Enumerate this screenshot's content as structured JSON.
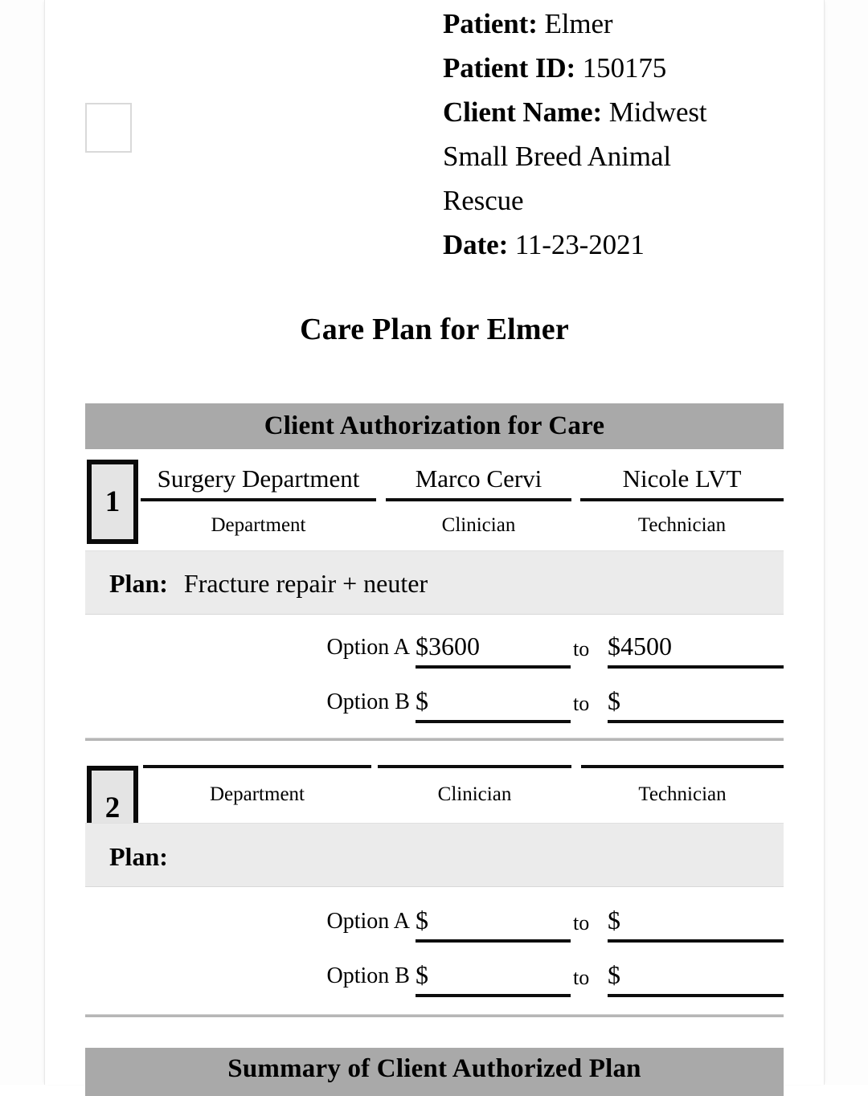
{
  "document": {
    "title": "Care Plan for Elmer",
    "header": {
      "patient_label": "Patient:",
      "patient_value": "Elmer",
      "patient_id_label": "Patient ID:",
      "patient_id_value": "150175",
      "client_name_label": "Client Name:",
      "client_name_value": "Midwest",
      "client_name_cont_1": "Small Breed Animal",
      "client_name_cont_2": "Rescue",
      "date_label": "Date:",
      "date_value": "11-23-2021"
    },
    "banners": {
      "authorization": "Client Authorization for Care",
      "summary": "Summary of Client Authorized Plan"
    },
    "captions": {
      "department": "Department",
      "clinician": "Clinician",
      "technician": "Technician",
      "plan_label": "Plan:",
      "option_a": "Option A",
      "option_b": "Option B",
      "to": "to",
      "currency": "$"
    },
    "sections": [
      {
        "number": "1",
        "department": "Surgery Department",
        "clinician": "Marco Cervi",
        "technician": "Nicole LVT",
        "plan": "Fracture repair + neuter",
        "option_a_low": "$3600",
        "option_a_high": "$4500",
        "option_b_low": "$",
        "option_b_high": "$"
      },
      {
        "number": "2",
        "department": "",
        "clinician": "",
        "technician": "",
        "plan": "",
        "option_a_low": "$",
        "option_a_high": "$",
        "option_b_low": "$",
        "option_b_high": "$"
      }
    ],
    "colors": {
      "banner_gray": "#a9a9a9",
      "plan_strip_gray": "#ebebeb",
      "num_box_fill": "#e4e4e4",
      "rule_black": "#0d0d0d",
      "separator_gray": "#b6b6b6"
    }
  }
}
